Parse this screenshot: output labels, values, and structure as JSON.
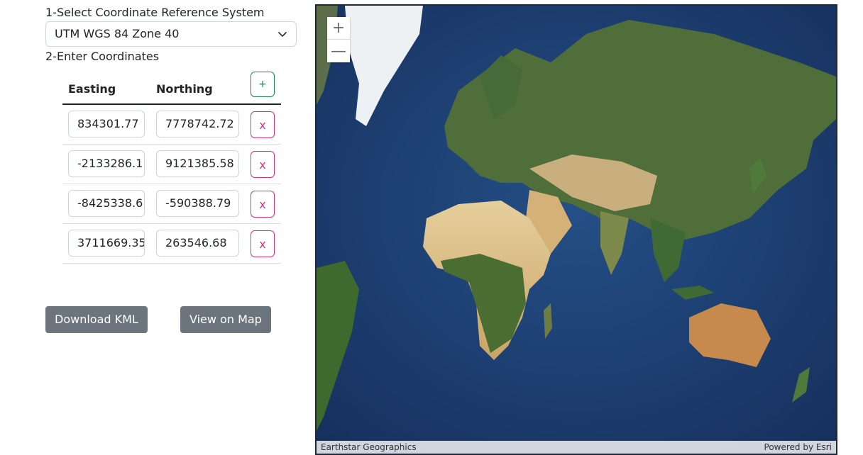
{
  "form": {
    "step1_label": "1-Select Coordinate Reference System",
    "crs_selected": "UTM WGS 84 Zone 40",
    "step2_label": "2-Enter Coordinates",
    "col_easting": "Easting",
    "col_northing": "Northing",
    "add_label": "+",
    "rows": [
      {
        "easting": "834301.77",
        "northing": "7778742.72",
        "delete_label": "x"
      },
      {
        "easting": "-2133286.1",
        "northing": "9121385.58",
        "delete_label": "x"
      },
      {
        "easting": "-8425338.6",
        "northing": "-590388.79",
        "delete_label": "x"
      },
      {
        "easting": "3711669.35",
        "northing": "263546.68",
        "delete_label": "x"
      }
    ],
    "download_label": "Download KML",
    "view_label": "View on Map"
  },
  "map": {
    "zoom_in": "+",
    "zoom_out": "—",
    "attribution_left": "Earthstar Geographics",
    "attribution_right": "Powered by Esri"
  },
  "icons": {
    "select": "chevron-down-icon"
  }
}
